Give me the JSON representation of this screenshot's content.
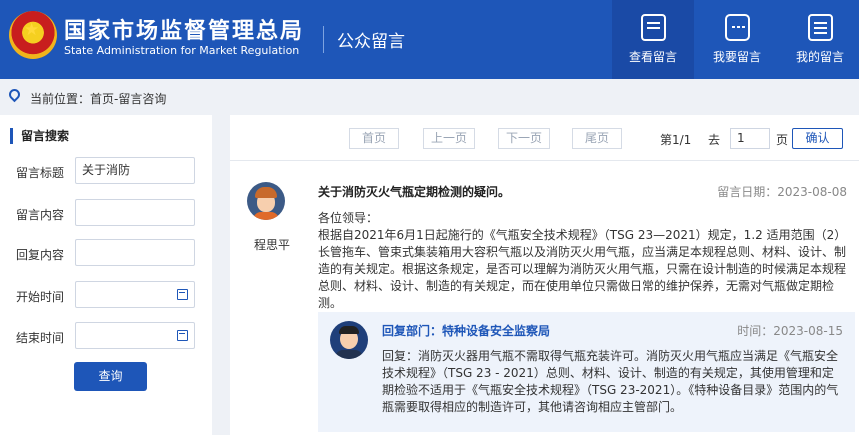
{
  "header": {
    "title": "国家市场监督管理总局",
    "subtitle": "State Administration for Market Regulation",
    "section": "公众留言",
    "nav": [
      {
        "label": "查看留言",
        "icon": "search-doc-icon"
      },
      {
        "label": "我要留言",
        "icon": "chat-icon"
      },
      {
        "label": "我的留言",
        "icon": "list-icon"
      }
    ]
  },
  "breadcrumb": {
    "text": "当前位置：首页-留言咨询"
  },
  "search": {
    "title": "留言搜索",
    "fields": {
      "title_label": "留言标题",
      "title_value": "关于消防",
      "content_label": "留言内容",
      "reply_label": "回复内容",
      "start_label": "开始时间",
      "end_label": "结束时间"
    },
    "submit": "查询"
  },
  "pager": {
    "first": "首页",
    "prev": "上一页",
    "next": "下一页",
    "last": "尾页",
    "page_info": "第1/1",
    "goto_label": "去",
    "page_value": "1",
    "page_unit": "页",
    "confirm": "确认"
  },
  "message": {
    "asker": "程思平",
    "title": "关于消防灭火气瓶定期检测的疑问。",
    "date": "留言日期：2023-08-08",
    "body": "各位领导：\n根据自2021年6月1日起施行的《气瓶安全技术规程》（TSG 23—2021）规定，1.2 适用范围（2）长管拖车、管束式集装箱用大容积气瓶以及消防灭火用气瓶，应当满足本规程总则、材料、设计、制造的有关规定。根据这条规定，是否可以理解为消防灭火用气瓶，只需在设计制造的时候满足本规程总则、材料、设计、制造的有关规定，而在使用单位只需做日常的维护保养，无需对气瓶做定期检测。"
  },
  "reply": {
    "dept": "回复部门：特种设备安全监察局",
    "time": "时间：2023-08-15",
    "body": "回复：消防灭火器用气瓶不需取得气瓶充装许可。消防灭火用气瓶应当满足《气瓶安全技术规程》（TSG 23 - 2021）总则、材料、设计、制造的有关规定，其使用管理和定期检验不适用于《气瓶安全技术规程》（TSG 23-2021）。《特种设备目录》范围内的气瓶需要取得相应的制造许可，其他请咨询相应主管部门。"
  }
}
